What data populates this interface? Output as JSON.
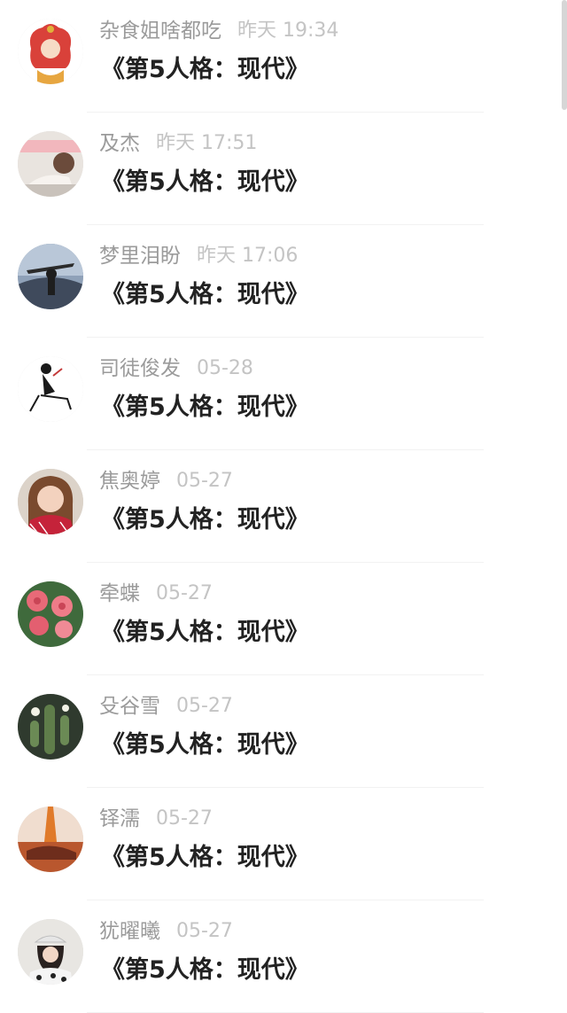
{
  "messages": [
    {
      "name": "杂食姐啥都吃",
      "time": "昨天 19:34",
      "text": "《第5人格：现代》",
      "avatar": "illustrated-figure-avatar"
    },
    {
      "name": "及杰",
      "time": "昨天 17:51",
      "text": "《第5人格：现代》",
      "avatar": "girl-photo-avatar"
    },
    {
      "name": "梦里泪盼",
      "time": "昨天 17:06",
      "text": "《第5人格：现代》",
      "avatar": "silhouette-sky-avatar"
    },
    {
      "name": "司徒俊发",
      "time": "05-28",
      "text": "《第5人格：现代》",
      "avatar": "sketch-figure-avatar"
    },
    {
      "name": "焦奥婷",
      "time": "05-27",
      "text": "《第5人格：现代》",
      "avatar": "girl-portrait-avatar"
    },
    {
      "name": "牵蝶",
      "time": "05-27",
      "text": "《第5人格：现代》",
      "avatar": "roses-avatar"
    },
    {
      "name": "殳谷雪",
      "time": "05-27",
      "text": "《第5人格：现代》",
      "avatar": "cactus-avatar"
    },
    {
      "name": "铎濡",
      "time": "05-27",
      "text": "《第5人格：现代》",
      "avatar": "sunset-figure-avatar"
    },
    {
      "name": "犹曜曦",
      "time": "05-27",
      "text": "《第5人格：现代》",
      "avatar": "girl-hat-avatar"
    }
  ]
}
